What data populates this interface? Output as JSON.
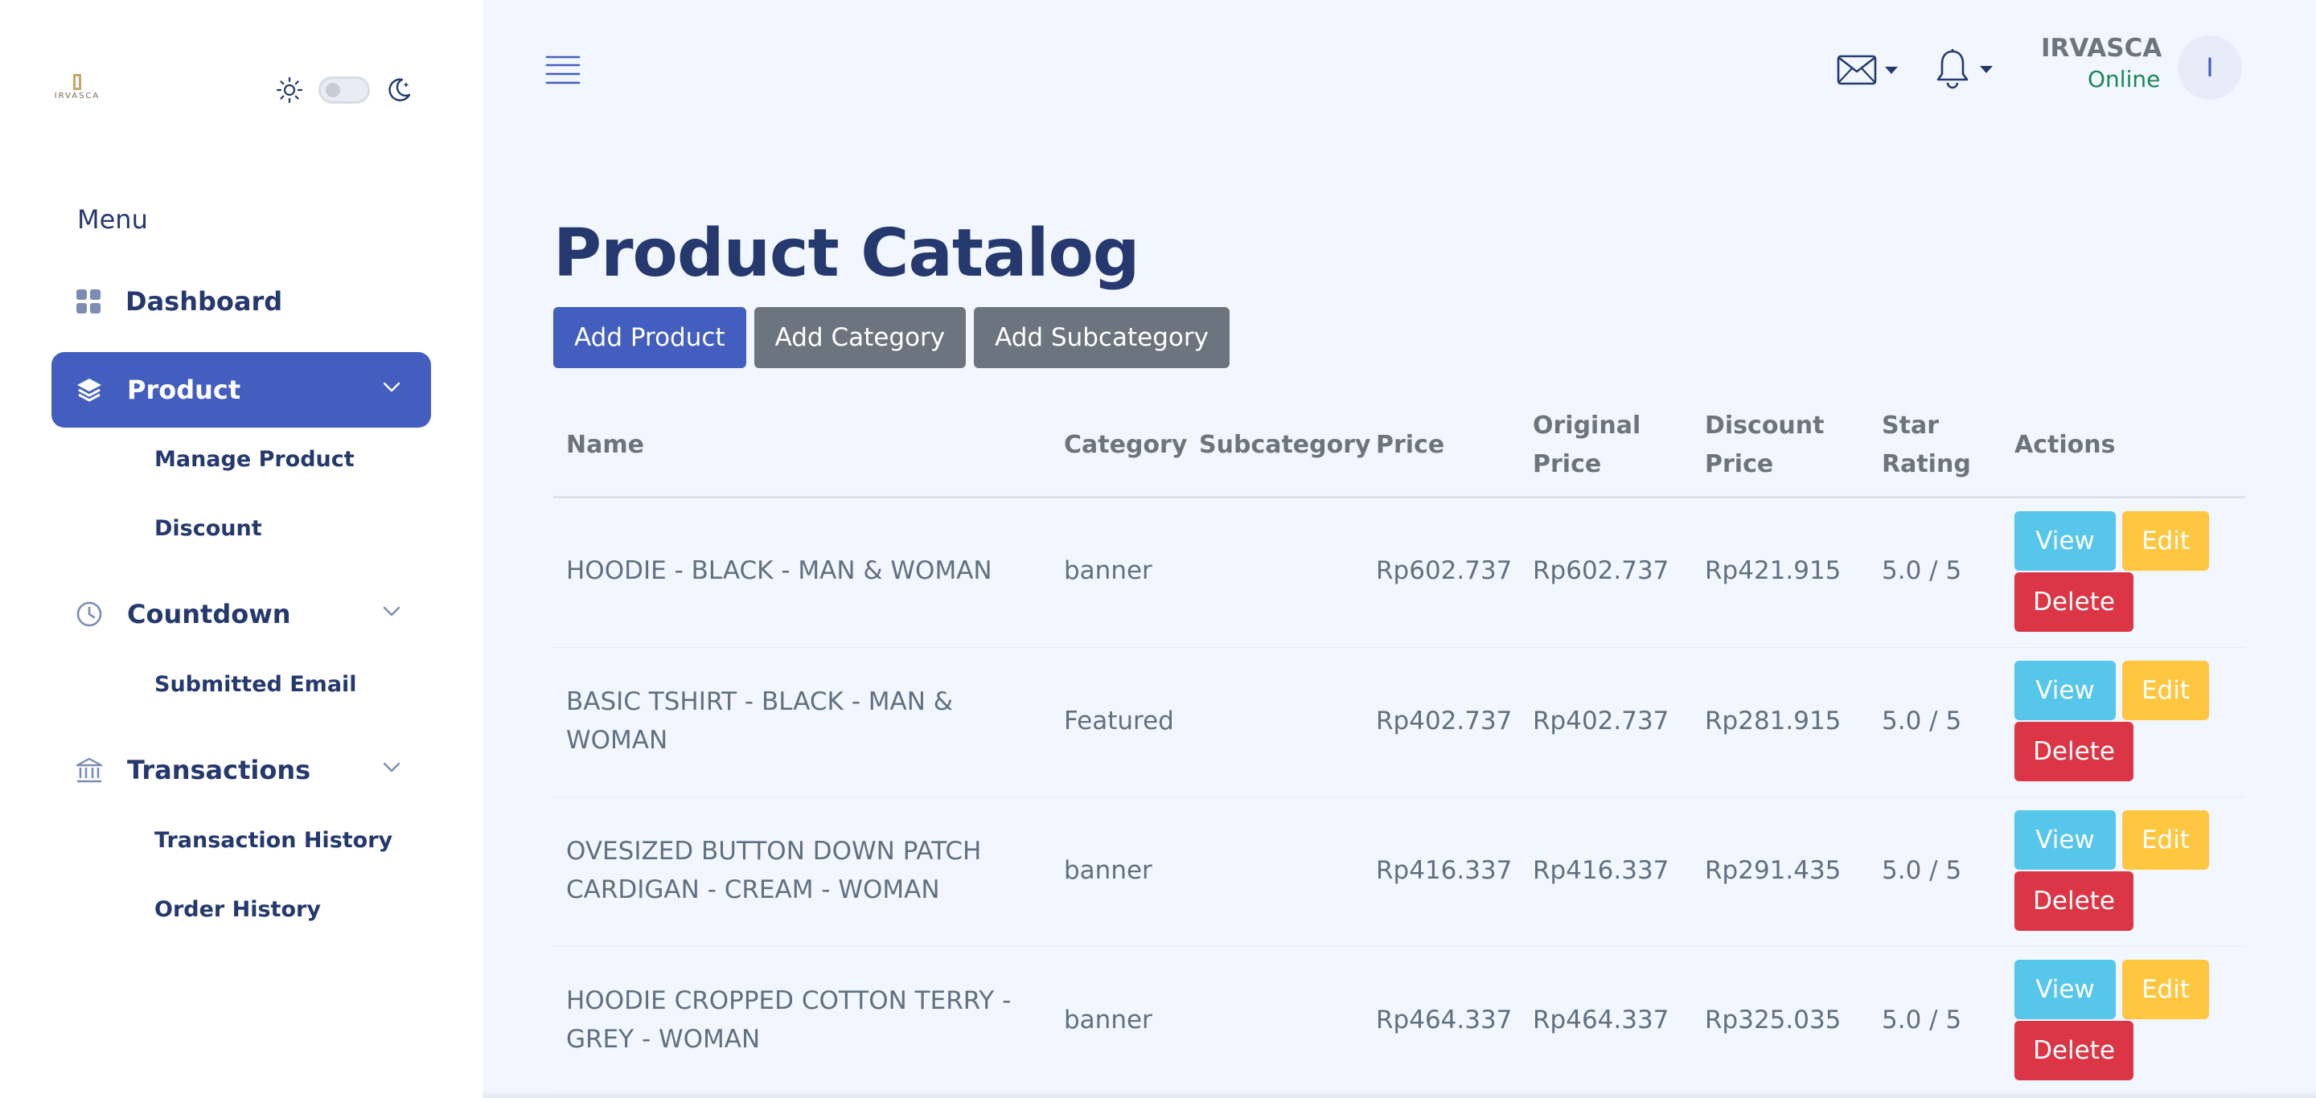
{
  "brand": {
    "logo_text": "IRVASCA"
  },
  "sidebar": {
    "menu_title": "Menu",
    "items": [
      {
        "label": "Dashboard",
        "icon": "grid-icon"
      },
      {
        "label": "Product",
        "icon": "layers-icon",
        "active": true
      },
      {
        "label": "Countdown",
        "icon": "clock-icon"
      },
      {
        "label": "Transactions",
        "icon": "bank-icon"
      }
    ],
    "subitems": {
      "product": [
        "Manage Product",
        "Discount"
      ],
      "countdown": [
        "Submitted Email"
      ],
      "transactions": [
        "Transaction History",
        "Order History"
      ]
    }
  },
  "header": {
    "user_name": "IRVASCA",
    "user_status": "Online",
    "avatar_initial": "I"
  },
  "main": {
    "title": "Product Catalog",
    "buttons": {
      "add_product": "Add Product",
      "add_category": "Add Category",
      "add_subcategory": "Add Subcategory"
    },
    "columns": {
      "name": "Name",
      "category": "Category",
      "subcategory": "Subcategory",
      "price": "Price",
      "original_price_1": "Original",
      "original_price_2": "Price",
      "discount_price_1": "Discount",
      "discount_price_2": "Price",
      "star_rating_1": "Star",
      "star_rating_2": "Rating",
      "actions": "Actions"
    },
    "row_actions": {
      "view": "View",
      "edit": "Edit",
      "delete": "Delete"
    },
    "rows": [
      {
        "name_1": "HOODIE - BLACK - MAN & WOMAN",
        "name_2": "",
        "category": "banner",
        "subcategory": "",
        "price": "Rp602.737",
        "original_price": "Rp602.737",
        "discount_price": "Rp421.915",
        "rating": "5.0 / 5"
      },
      {
        "name_1": "BASIC TSHIRT - BLACK - MAN &",
        "name_2": "WOMAN",
        "category": "Featured",
        "subcategory": "",
        "price": "Rp402.737",
        "original_price": "Rp402.737",
        "discount_price": "Rp281.915",
        "rating": "5.0 / 5"
      },
      {
        "name_1": "OVESIZED BUTTON DOWN PATCH",
        "name_2": "CARDIGAN - CREAM - WOMAN",
        "category": "banner",
        "subcategory": "",
        "price": "Rp416.337",
        "original_price": "Rp416.337",
        "discount_price": "Rp291.435",
        "rating": "5.0 / 5"
      },
      {
        "name_1": "HOODIE CROPPED COTTON TERRY -",
        "name_2": "GREY - WOMAN",
        "category": "banner",
        "subcategory": "",
        "price": "Rp464.337",
        "original_price": "Rp464.337",
        "discount_price": "Rp325.035",
        "rating": "5.0 / 5"
      }
    ]
  },
  "colors": {
    "primary": "#435ebe",
    "secondary": "#6c757d",
    "info": "#56c6ea",
    "warning": "#ffc63f",
    "danger": "#dc3545",
    "online": "#198754",
    "background": "#f2f7ff"
  }
}
